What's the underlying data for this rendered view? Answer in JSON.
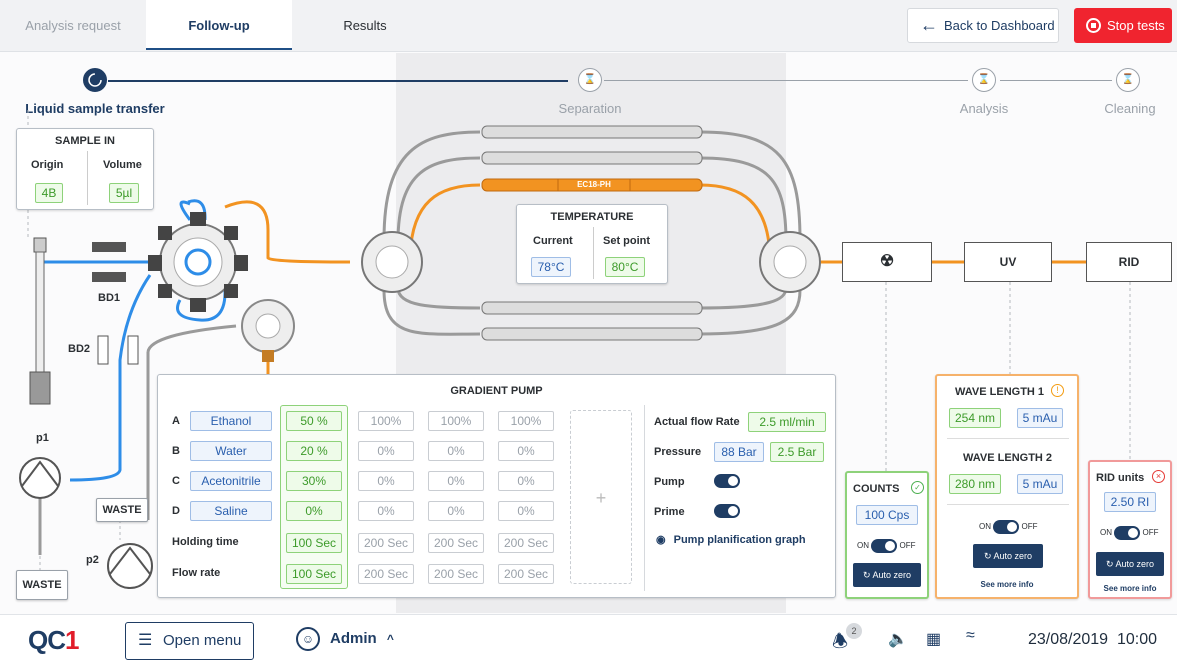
{
  "tabs": [
    {
      "label": "Analysis request"
    },
    {
      "label": "Follow-up"
    },
    {
      "label": "Results"
    }
  ],
  "header": {
    "back_label": "Back to Dashboard",
    "stop_label": "Stop tests"
  },
  "steps": [
    {
      "label": "Liquid sample transfer",
      "state": "active"
    },
    {
      "label": "Separation",
      "state": "pending"
    },
    {
      "label": "Analysis",
      "state": "pending"
    },
    {
      "label": "Cleaning",
      "state": "pending"
    }
  ],
  "sample_in": {
    "title": "SAMPLE IN",
    "origin_label": "Origin",
    "origin_value": "4B",
    "volume_label": "Volume",
    "volume_value": "5µl"
  },
  "labels": {
    "bd1": "BD1",
    "bd2": "BD2",
    "p1": "p1",
    "p2": "p2",
    "waste1": "WASTE",
    "waste2": "WASTE",
    "column": "EC18-PH"
  },
  "temperature": {
    "title": "TEMPERATURE",
    "current_label": "Current",
    "current_value": "78°C",
    "setpoint_label": "Set point",
    "setpoint_value": "80°C"
  },
  "detectors": {
    "uv": "UV",
    "rid": "RID"
  },
  "gradient": {
    "title": "GRADIENT PUMP",
    "rows": [
      {
        "letter": "A",
        "solvent": "Ethanol",
        "values": [
          "50 %",
          "100%",
          "100%",
          "100%"
        ]
      },
      {
        "letter": "B",
        "solvent": "Water",
        "values": [
          "20 %",
          "0%",
          "0%",
          "0%"
        ]
      },
      {
        "letter": "C",
        "solvent": "Acetonitrile",
        "values": [
          "30%",
          "0%",
          "0%",
          "0%"
        ]
      },
      {
        "letter": "D",
        "solvent": "Saline",
        "values": [
          "0%",
          "0%",
          "0%",
          "0%"
        ]
      }
    ],
    "holding_label": "Holding time",
    "holding": [
      "100 Sec",
      "200 Sec",
      "200 Sec",
      "200 Sec"
    ],
    "flow_label": "Flow rate",
    "flow": [
      "100 Sec",
      "200 Sec",
      "200 Sec",
      "200 Sec"
    ],
    "add_symbol": "+",
    "actual_flow_label": "Actual flow Rate",
    "actual_flow_value": "2.5 ml/min",
    "pressure_label": "Pressure",
    "pressure_value1": "88 Bar",
    "pressure_value2": "2.5 Bar",
    "pump_label": "Pump",
    "prime_label": "Prime",
    "pump_on": true,
    "prime_on": true,
    "graph_link": "Pump planification graph"
  },
  "counts": {
    "title": "COUNTS",
    "value": "100 Cps",
    "on": "ON",
    "off": "OFF",
    "autozero": "Auto zero",
    "status_color": "#4caf50"
  },
  "uv_panel": {
    "title1": "WAVE LENGTH 1",
    "wl1_a": "254 nm",
    "wl1_b": "5 mAu",
    "title2": "WAVE LENGTH 2",
    "wl2_a": "280 nm",
    "wl2_b": "5 mAu",
    "on": "ON",
    "off": "OFF",
    "autozero": "Auto zero",
    "seemore": "See more info",
    "status_color": "#f39c12"
  },
  "rid_panel": {
    "title": "RID units",
    "value": "2.50 RI",
    "on": "ON",
    "off": "OFF",
    "autozero": "Auto zero",
    "seemore": "See more info",
    "status_color": "#e53935"
  },
  "bottom": {
    "logo_a": "QC",
    "logo_b": "1",
    "menu_label": "Open menu",
    "user": "Admin",
    "notif_count": "2",
    "datetime": "23/08/2019  10:00"
  }
}
